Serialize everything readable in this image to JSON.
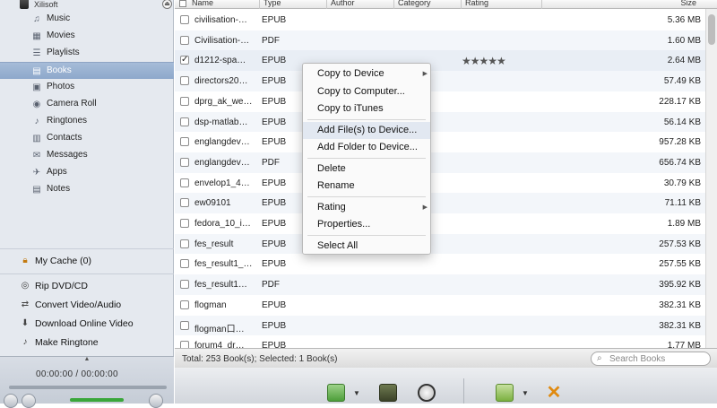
{
  "sidebar": {
    "device_label": "Xilisoft",
    "items": [
      {
        "label": "Music",
        "icon": "music-note-icon"
      },
      {
        "label": "Movies",
        "icon": "film-icon"
      },
      {
        "label": "Playlists",
        "icon": "playlist-icon"
      },
      {
        "label": "Books",
        "icon": "book-icon",
        "selected": true
      },
      {
        "label": "Photos",
        "icon": "photo-icon"
      },
      {
        "label": "Camera Roll",
        "icon": "camera-icon"
      },
      {
        "label": "Ringtones",
        "icon": "bell-icon"
      },
      {
        "label": "Contacts",
        "icon": "contacts-icon"
      },
      {
        "label": "Messages",
        "icon": "message-icon"
      },
      {
        "label": "Apps",
        "icon": "apps-icon"
      },
      {
        "label": "Notes",
        "icon": "notes-icon"
      }
    ],
    "cache": {
      "label": "My Cache (0)",
      "icon": "lock-icon"
    },
    "tools": [
      {
        "label": "Rip DVD/CD",
        "icon": "disc-icon"
      },
      {
        "label": "Convert Video/Audio",
        "icon": "convert-icon"
      },
      {
        "label": "Download Online Video",
        "icon": "download-icon"
      },
      {
        "label": "Make Ringtone",
        "icon": "bell-icon"
      }
    ]
  },
  "player": {
    "time": "00:00:00 / 00:00:00"
  },
  "table": {
    "headers": {
      "name": "Name",
      "type": "Type",
      "author": "Author",
      "category": "Category",
      "rating": "Rating",
      "size": "Size"
    },
    "rows": [
      {
        "name": "civilisation-…",
        "type": "EPUB",
        "size": "5.36 MB",
        "checked": false,
        "rating": ""
      },
      {
        "name": "Civilisation-…",
        "type": "PDF",
        "size": "1.60 MB",
        "checked": false,
        "rating": ""
      },
      {
        "name": "d1212-spa…",
        "type": "EPUB",
        "size": "2.64 MB",
        "checked": true,
        "rating": "★★★★★"
      },
      {
        "name": "directors20…",
        "type": "EPUB",
        "size": "57.49 KB",
        "checked": false,
        "rating": ""
      },
      {
        "name": "dprg_ak_we…",
        "type": "EPUB",
        "size": "228.17 KB",
        "checked": false,
        "rating": ""
      },
      {
        "name": "dsp-matlab…",
        "type": "EPUB",
        "size": "56.14 KB",
        "checked": false,
        "rating": ""
      },
      {
        "name": "englangdev…",
        "type": "EPUB",
        "size": "957.28 KB",
        "checked": false,
        "rating": ""
      },
      {
        "name": "englangdev…",
        "type": "PDF",
        "size": "656.74 KB",
        "checked": false,
        "rating": ""
      },
      {
        "name": "envelop1_4…",
        "type": "EPUB",
        "size": "30.79 KB",
        "checked": false,
        "rating": ""
      },
      {
        "name": "ew09101",
        "type": "EPUB",
        "size": "71.11 KB",
        "checked": false,
        "rating": ""
      },
      {
        "name": "fedora_10_i…",
        "type": "EPUB",
        "size": "1.89 MB",
        "checked": false,
        "rating": ""
      },
      {
        "name": "fes_result",
        "type": "EPUB",
        "size": "257.53 KB",
        "checked": false,
        "rating": ""
      },
      {
        "name": "fes_result1_…",
        "type": "EPUB",
        "size": "257.55 KB",
        "checked": false,
        "rating": ""
      },
      {
        "name": "fes_result1…",
        "type": "PDF",
        "size": "395.92 KB",
        "checked": false,
        "rating": ""
      },
      {
        "name": "flogman",
        "type": "EPUB",
        "size": "382.31 KB",
        "checked": false,
        "rating": ""
      },
      {
        "name": "flogman口…",
        "type": "EPUB",
        "size": "382.31 KB",
        "checked": false,
        "rating": ""
      },
      {
        "name": "forum4_dr…",
        "type": "EPUB",
        "size": "1.77 MB",
        "checked": false,
        "rating": ""
      }
    ]
  },
  "status": {
    "text": "Total: 253 Book(s); Selected: 1 Book(s)"
  },
  "search": {
    "placeholder": "Search Books"
  },
  "context_menu": [
    {
      "label": "Copy to Device",
      "submenu": true
    },
    {
      "label": "Copy to Computer...",
      "submenu": false
    },
    {
      "label": "Copy to iTunes",
      "submenu": false
    },
    {
      "separator": true
    },
    {
      "label": "Add File(s) to Device...",
      "submenu": false,
      "hover": true
    },
    {
      "label": "Add Folder to Device...",
      "submenu": false
    },
    {
      "separator": true
    },
    {
      "label": "Delete",
      "submenu": false
    },
    {
      "label": "Rename",
      "submenu": false
    },
    {
      "separator": true
    },
    {
      "label": "Rating",
      "submenu": true
    },
    {
      "label": "Properties...",
      "submenu": false
    },
    {
      "separator": true
    },
    {
      "label": "Select All",
      "submenu": false
    }
  ],
  "colors": {
    "selection": "#8ea8cb",
    "accent_green": "#3aa63a",
    "accent_orange": "#e08a10"
  }
}
